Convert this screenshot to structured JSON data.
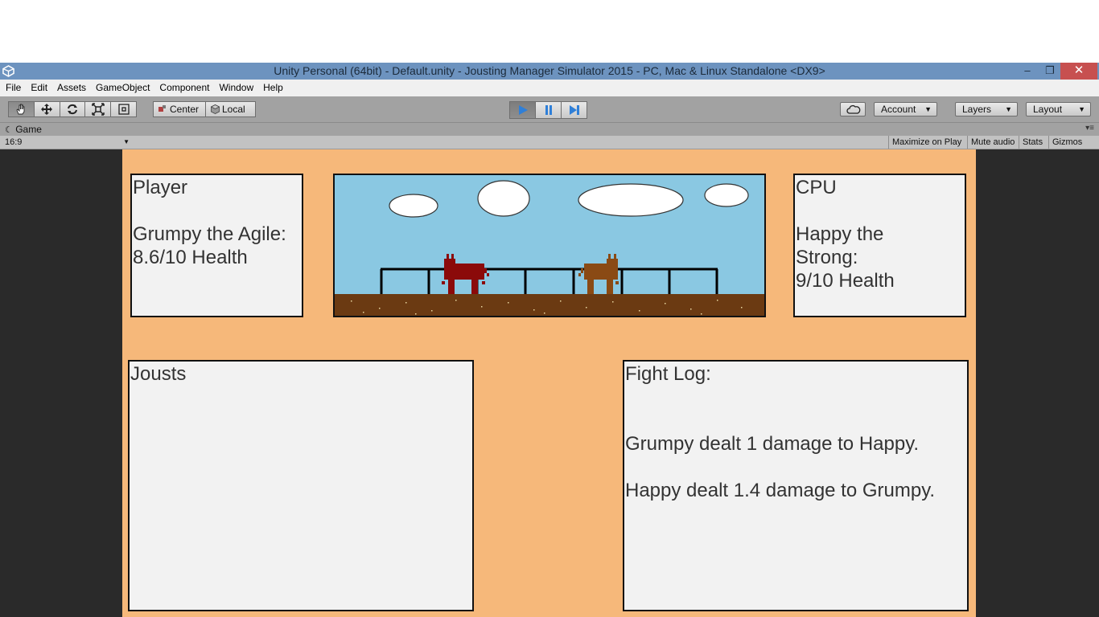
{
  "window": {
    "title": "Unity Personal (64bit) - Default.unity - Jousting Manager Simulator 2015 - PC, Mac & Linux Standalone <DX9>",
    "minimize_glyph": "–",
    "maximize_glyph": "❐",
    "close_glyph": "✕"
  },
  "menu": [
    "File",
    "Edit",
    "Assets",
    "GameObject",
    "Component",
    "Window",
    "Help"
  ],
  "toolbar": {
    "tools": [
      "hand-icon",
      "move-icon",
      "rotate-icon",
      "scale-icon",
      "rect-icon"
    ],
    "active_tool": "hand-icon",
    "pivot_center": "Center",
    "pivot_local": "Local",
    "play_active": true,
    "account_label": "Account",
    "layers_label": "Layers",
    "layout_label": "Layout"
  },
  "game_panel": {
    "tab_label": "Game",
    "aspect": "16:9",
    "maximize_on_play": "Maximize on Play",
    "mute_audio": "Mute audio",
    "stats": "Stats",
    "gizmos": "Gizmos"
  },
  "game": {
    "player_text": "Player\n\nGrumpy the Agile:\n8.6/10 Health",
    "cpu_text": "CPU\n\nHappy the\nStrong:\n9/10 Health",
    "jousts_text": "Jousts",
    "log_text": "Fight Log:\n\n\nGrumpy dealt 1 damage to Happy.\n\nHappy dealt 1.4 damage to Grumpy.",
    "colors": {
      "background": "#f6b87a",
      "sky": "#8ac8e2",
      "ground": "#6b3a12",
      "player_horse": "#8b0a0a",
      "cpu_horse": "#8a4a14"
    }
  }
}
